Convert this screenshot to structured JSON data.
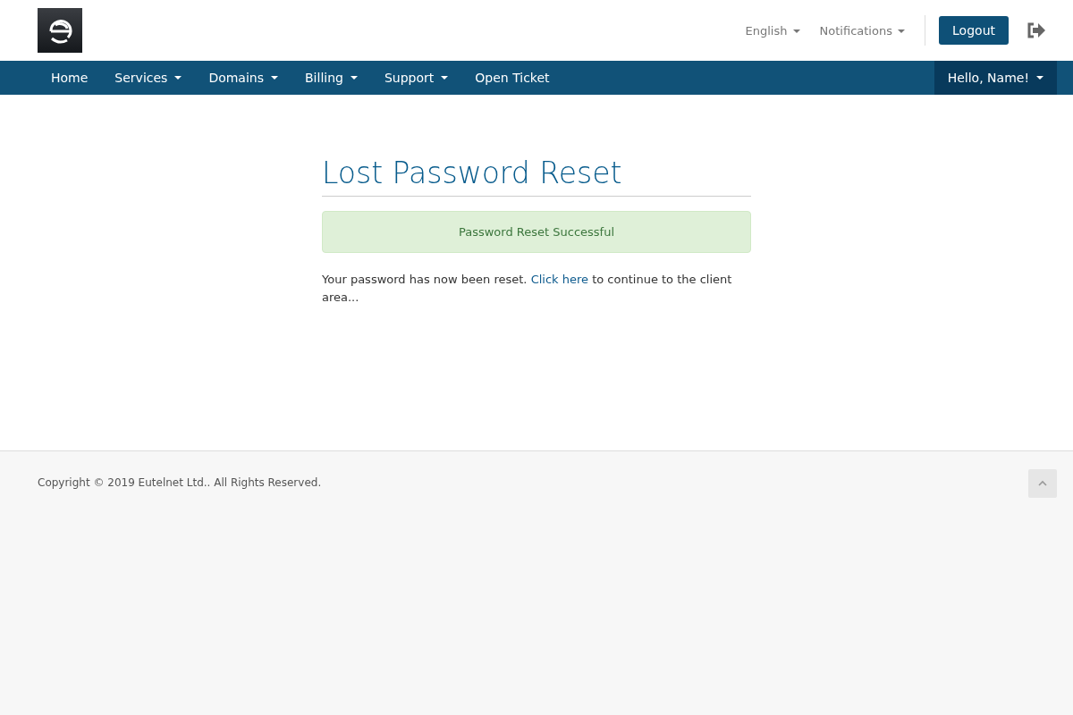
{
  "header": {
    "language": "English",
    "notifications": "Notifications",
    "logout": "Logout"
  },
  "nav": {
    "items": [
      {
        "label": "Home",
        "dropdown": false
      },
      {
        "label": "Services",
        "dropdown": true
      },
      {
        "label": "Domains",
        "dropdown": true
      },
      {
        "label": "Billing",
        "dropdown": true
      },
      {
        "label": "Support",
        "dropdown": true
      },
      {
        "label": "Open Ticket",
        "dropdown": false
      }
    ],
    "user": "Hello, Name!"
  },
  "main": {
    "title": "Lost Password Reset",
    "alert": "Password Reset Successful",
    "text_before": "Your password has now been reset.",
    "link": "Click here",
    "text_after": "to continue to the client area..."
  },
  "footer": {
    "copyright": "Copyright © 2019 Eutelnet Ltd.. All Rights Reserved."
  }
}
